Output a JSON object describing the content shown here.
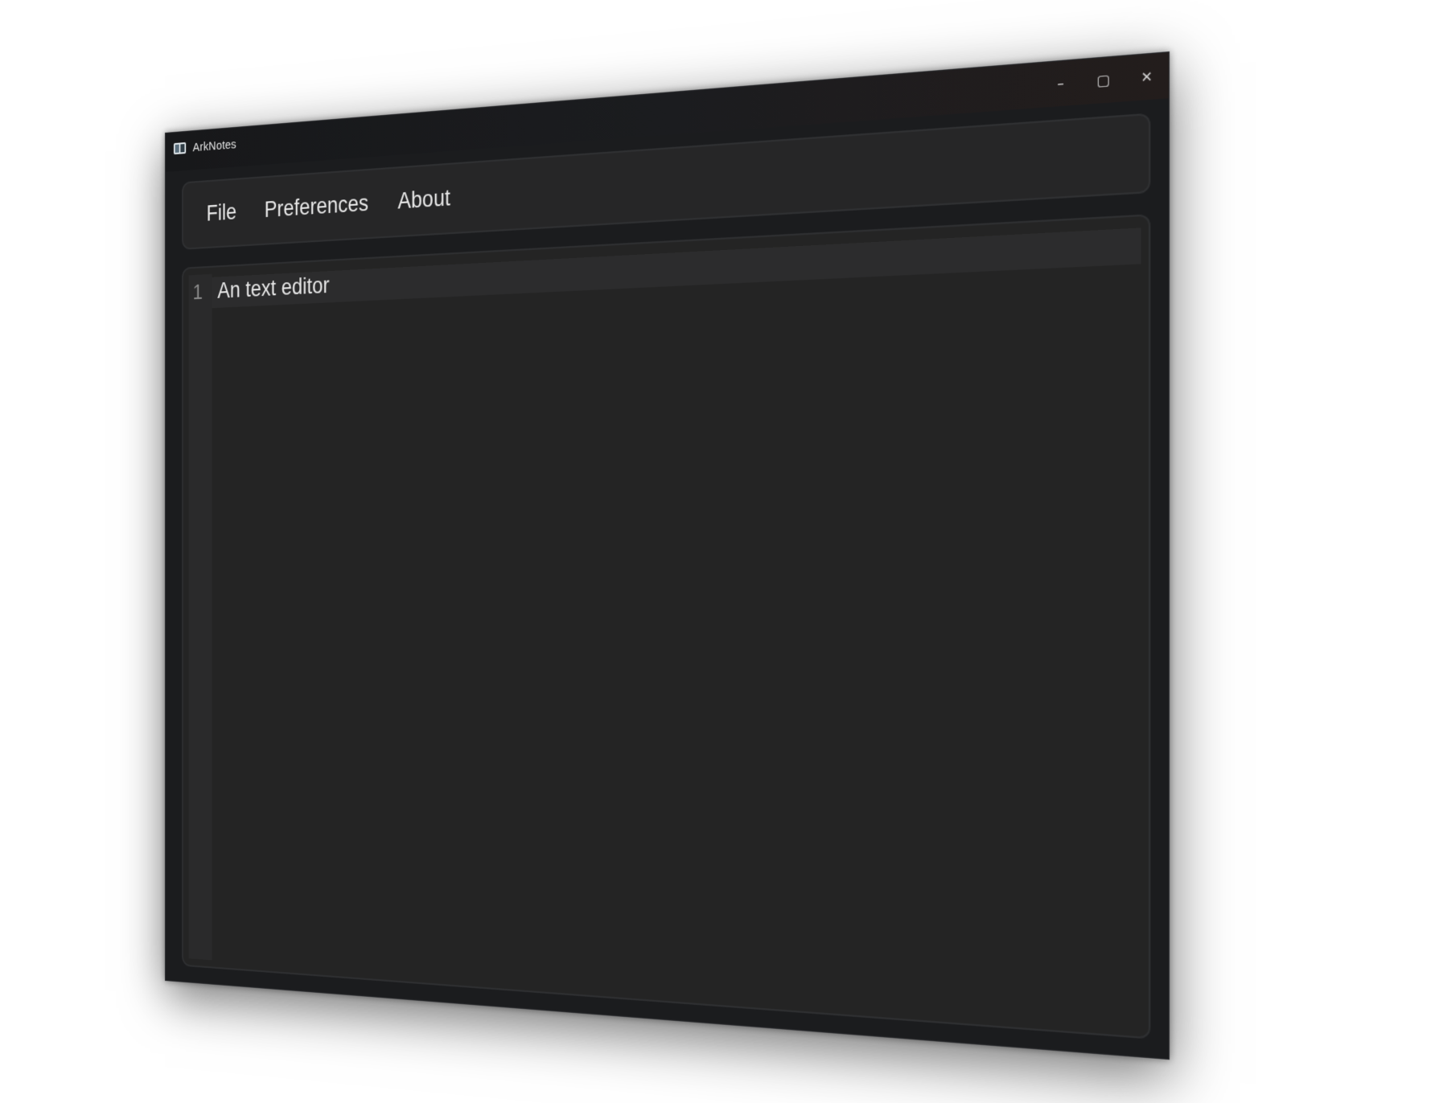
{
  "window": {
    "title": "ArkNotes",
    "controls": {
      "minimize": "–",
      "maximize": "▢",
      "close": "✕"
    }
  },
  "menu": {
    "items": [
      "File",
      "Preferences",
      "About"
    ]
  },
  "editor": {
    "lines": [
      {
        "number": "1",
        "text": "An text editor"
      }
    ]
  }
}
